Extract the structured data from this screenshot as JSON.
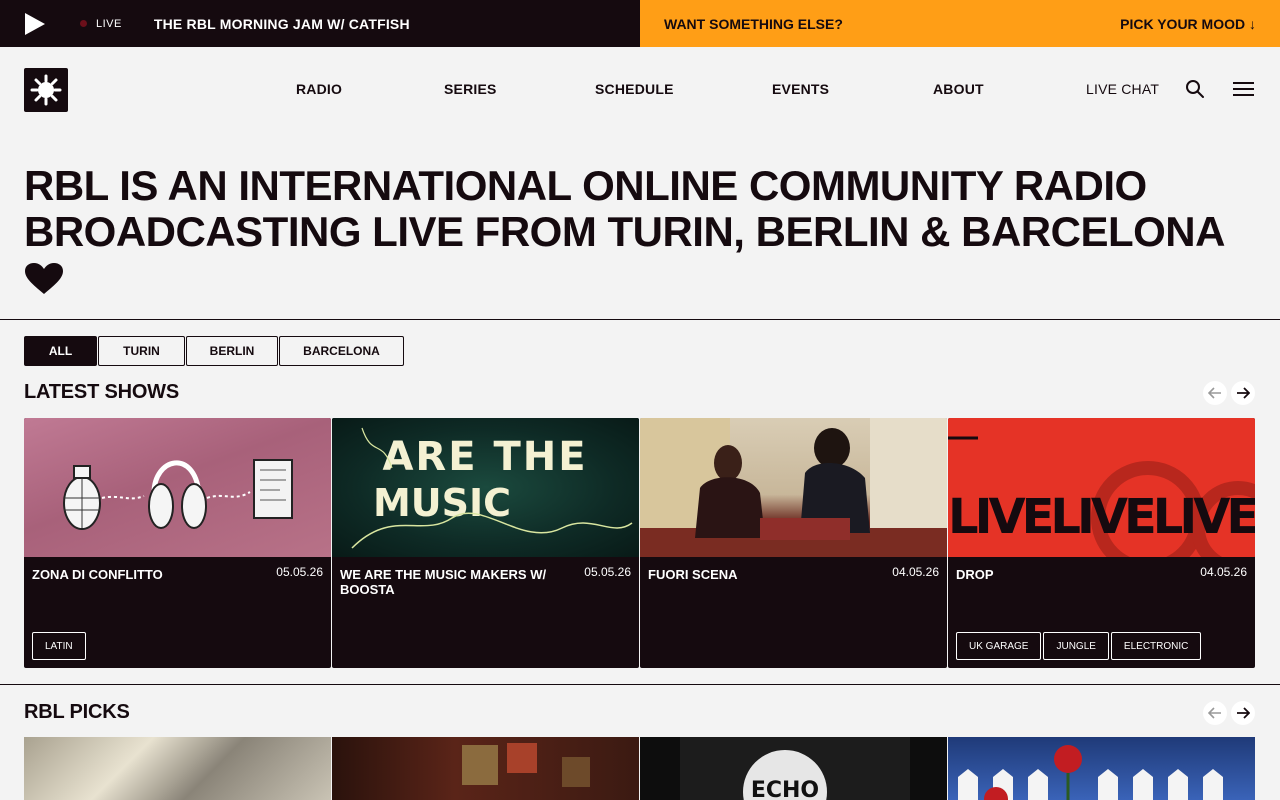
{
  "player": {
    "live_label": "LIVE",
    "now_playing": "THE RBL MORNING JAM W/ CATFISH",
    "mood_prompt": "WANT SOMETHING ELSE?",
    "mood_button": "PICK YOUR MOOD ↓"
  },
  "nav": {
    "links": [
      "RADIO",
      "SERIES",
      "SCHEDULE",
      "EVENTS",
      "ABOUT"
    ],
    "live_chat": "LIVE CHAT"
  },
  "hero": {
    "line1": "RBL IS AN INTERNATIONAL ONLINE COMMUNITY RADIO",
    "line2": "BROADCASTING LIVE FROM TURIN, BERLIN & BARCELONA"
  },
  "filters": [
    "ALL",
    "TURIN",
    "BERLIN",
    "BARCELONA"
  ],
  "latest": {
    "title": "LATEST SHOWS",
    "shows": [
      {
        "title": "ZONA DI CONFLITTO",
        "date": "05.05.26",
        "tags": [
          "LATIN"
        ]
      },
      {
        "title": "WE ARE THE MUSIC MAKERS W/ BOOSTA",
        "date": "05.05.26",
        "tags": [],
        "art_text": "ARE THE MUSIC"
      },
      {
        "title": "FUORI SCENA",
        "date": "04.05.26",
        "tags": []
      },
      {
        "title": "DROP",
        "date": "04.05.26",
        "tags": [
          "UK GARAGE",
          "JUNGLE",
          "ELECTRONIC"
        ],
        "art_text": "LIVELIVELIVEL"
      }
    ]
  },
  "picks": {
    "title": "RBL PICKS"
  },
  "colors": {
    "dark": "#150a0f",
    "accent": "#ff9e16",
    "background": "#f3f3f3",
    "drop_red": "#e53326"
  }
}
